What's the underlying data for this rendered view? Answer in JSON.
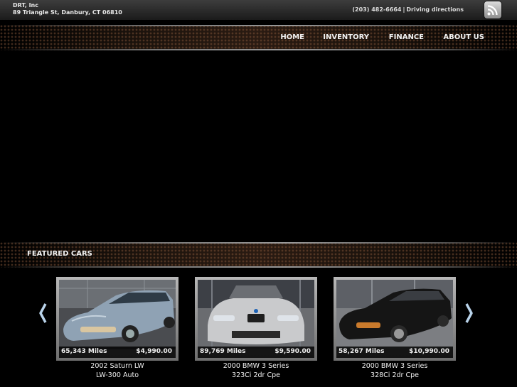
{
  "header": {
    "dealer_name": "DRT, Inc",
    "address": "89 Triangle St, Danbury, CT 06810",
    "phone": "(203) 482-6664",
    "separator": "|",
    "directions_link": "Driving directions",
    "rss_icon": "rss-feed-icon"
  },
  "nav": {
    "items": [
      {
        "label": "HOME"
      },
      {
        "label": "INVENTORY"
      },
      {
        "label": "FINANCE"
      },
      {
        "label": "ABOUT US"
      }
    ]
  },
  "featured": {
    "title": "FEATURED CARS",
    "prev_icon": "chevron-left-icon",
    "next_icon": "chevron-right-icon",
    "cars": [
      {
        "miles": "65,343 Miles",
        "price": "$4,990.00",
        "name_line1": "2002 Saturn LW",
        "name_line2": "LW-300 Auto",
        "color": "#8fa2b4"
      },
      {
        "miles": "89,769 Miles",
        "price": "$9,590.00",
        "name_line1": "2000 BMW 3 Series",
        "name_line2": "323Ci 2dr Cpe",
        "color": "#c9cacc"
      },
      {
        "miles": "58,267 Miles",
        "price": "$10,990.00",
        "name_line1": "2000 BMW 3 Series",
        "name_line2": "328Ci 2dr Cpe",
        "color": "#151515"
      }
    ]
  },
  "colors": {
    "background": "#000000",
    "arrow": "#b9d3ea"
  }
}
